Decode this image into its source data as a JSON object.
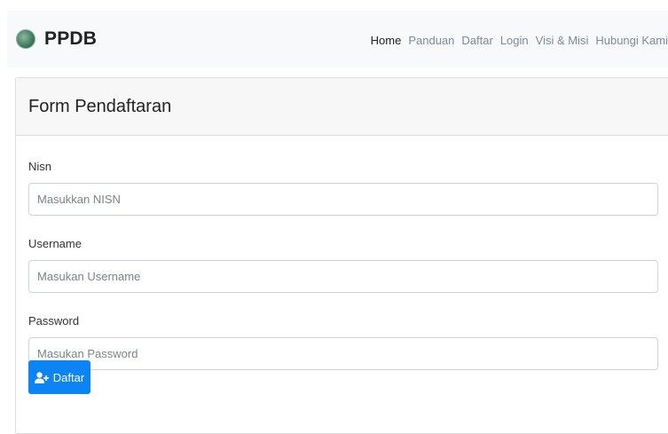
{
  "navbar": {
    "brand": "PPDB",
    "logo_icon": "school-emblem-icon",
    "links": [
      {
        "label": "Home",
        "active": true
      },
      {
        "label": "Panduan",
        "active": false
      },
      {
        "label": "Daftar",
        "active": false
      },
      {
        "label": "Login",
        "active": false
      },
      {
        "label": "Visi & Misi",
        "active": false
      },
      {
        "label": "Hubungi Kami",
        "active": false
      }
    ]
  },
  "form": {
    "title": "Form Pendaftaran",
    "fields": [
      {
        "label": "Nisn",
        "placeholder": "Masukkan NISN",
        "value": ""
      },
      {
        "label": "Username",
        "placeholder": "Masukan Username",
        "value": ""
      },
      {
        "label": "Password",
        "placeholder": "Masukan Password",
        "value": ""
      }
    ],
    "submit_label": "Daftar",
    "submit_icon": "user-plus-icon"
  },
  "colors": {
    "primary": "#0d84f5",
    "navbar_bg": "#f8f9fa",
    "nav_link": "#7d8a96"
  }
}
